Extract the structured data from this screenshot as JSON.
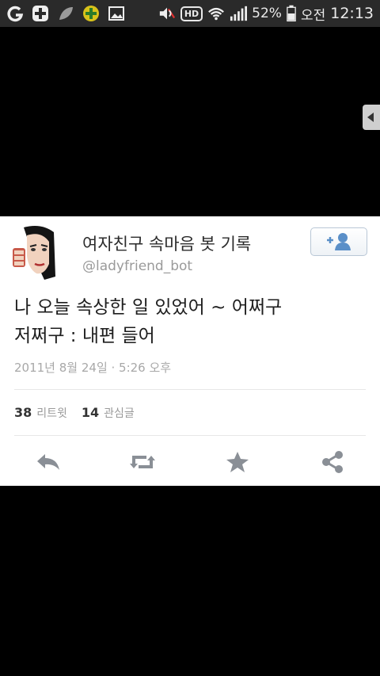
{
  "status_bar": {
    "battery": "52%",
    "period": "오전",
    "time": "12:13",
    "hd": "HD"
  },
  "tweet": {
    "display_name": "여자친구 속마음 봇 기록",
    "handle": "@ladyfriend_bot",
    "text_line1": "나 오늘 속상한 일 있었어 ~ 어쩌구",
    "text_line2": "저쩌구 : 내편 들어",
    "timestamp": "2011년 8월 24일 · 5:26 오후",
    "retweet_count": "38",
    "retweet_label": "리트윗",
    "favorite_count": "14",
    "favorite_label": "관심글"
  },
  "colors": {
    "status_bar_bg": "#2a2a2a",
    "card_bg": "#ffffff",
    "action_icon": "#8a8f96"
  },
  "icons": [
    "reply-icon",
    "retweet-icon",
    "favorite-icon",
    "share-icon",
    "follow-icon"
  ]
}
